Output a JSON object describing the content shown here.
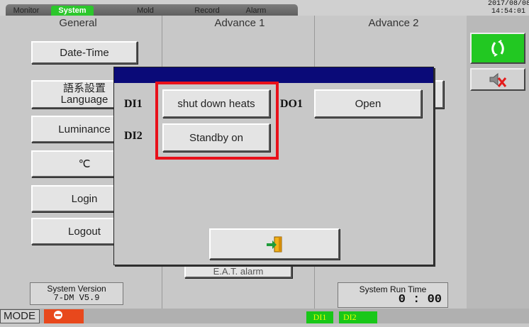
{
  "tabs": [
    "Monitor",
    "System",
    "Mold",
    "Record",
    "Alarm"
  ],
  "active_tab": "System",
  "clock": {
    "date": "2017/08/08",
    "time": "14:54:01"
  },
  "columns": {
    "general": "General",
    "advance1": "Advance 1",
    "advance2": "Advance 2"
  },
  "general_buttons": {
    "date_time": "Date-Time",
    "language_cn": "語系設置",
    "language": "Language",
    "luminance": "Luminance",
    "unit": "℃",
    "login": "Login",
    "logout": "Logout"
  },
  "behind_button": "E.A.T. alarm",
  "system_version": {
    "label": "System Version",
    "value": "7-DM V5.9"
  },
  "system_run_time": {
    "label": "System Run Time",
    "value": "0 : 00"
  },
  "status": {
    "mode": "MODE",
    "di1": "DI1",
    "di2": "DI2"
  },
  "dialog": {
    "di1_label": "DI1",
    "di1_value": "shut down heats",
    "di2_label": "DI2",
    "di2_value": "Standby on",
    "do1_label": "DO1",
    "do1_value": "Open"
  },
  "icons": {
    "refresh": "refresh-icon",
    "mute": "speaker-muted-icon",
    "exit": "exit-door-icon",
    "stop": "stop-icon"
  },
  "colors": {
    "active_tab": "#2cc72c",
    "dialog_title": "#0a0a78",
    "highlight": "#e8101a",
    "di_indicator": "#19c719"
  }
}
